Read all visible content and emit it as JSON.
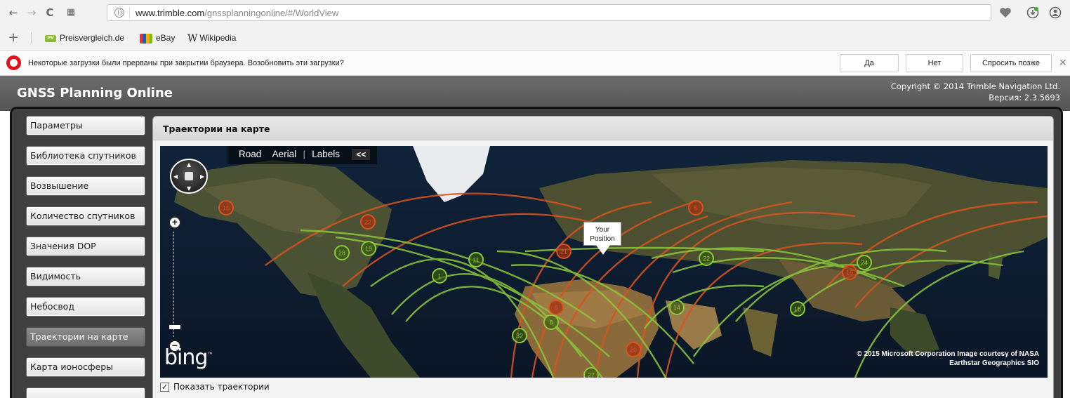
{
  "browser": {
    "url_host": "www.trimble.com",
    "url_path": "/gnssplanningonline/#/WorldView",
    "bookmarks": [
      {
        "label": "Preisvergleich.de"
      },
      {
        "label": "eBay"
      },
      {
        "label": "Wikipedia"
      }
    ],
    "notification": {
      "text": "Некоторые загрузки были прерваны при закрытии браузера. Возобновить эти загрузки?",
      "yes": "Да",
      "no": "Нет",
      "later": "Спросить позже"
    }
  },
  "app": {
    "title": "GNSS Planning Online",
    "copyright": "Copyright © 2014 Trimble Navigation Ltd.",
    "version": "Версия: 2.3.5693"
  },
  "sidebar": {
    "items": [
      {
        "label": "Параметры"
      },
      {
        "label": "Библиотека спутников"
      },
      {
        "label": "Возвышение"
      },
      {
        "label": "Количество спутников"
      },
      {
        "label": "Значения DOP"
      },
      {
        "label": "Видимость"
      },
      {
        "label": "Небосвод"
      },
      {
        "label": "Траектории на карте",
        "active": true
      },
      {
        "label": "Карта ионосферы"
      }
    ]
  },
  "panel": {
    "title": "Траектории на карте",
    "show_trajectories_label": "Показать траектории",
    "show_trajectories_checked": true
  },
  "map": {
    "nav": {
      "road": "Road",
      "aerial": "Aerial",
      "labels": "Labels",
      "collapse": "<<"
    },
    "position_label_1": "Your",
    "position_label_2": "Position",
    "logo": "bing",
    "credit_line_1": "© 2015 Microsoft Corporation   Image courtesy of NASA",
    "credit_line_2": "Earthstar Geographics  SIO",
    "colors": {
      "green": "#8ac93a",
      "orange": "#d9531e"
    },
    "satellites": [
      {
        "id": "15",
        "color": "orange"
      },
      {
        "id": "22",
        "color": "orange"
      },
      {
        "id": "28",
        "color": "green"
      },
      {
        "id": "19",
        "color": "green"
      },
      {
        "id": "1",
        "color": "green"
      },
      {
        "id": "11",
        "color": "green"
      },
      {
        "id": "21",
        "color": "orange"
      },
      {
        "id": "5",
        "color": "orange"
      },
      {
        "id": "22",
        "color": "green"
      },
      {
        "id": "16",
        "color": "orange"
      },
      {
        "id": "24",
        "color": "green"
      },
      {
        "id": "6",
        "color": "orange"
      },
      {
        "id": "8",
        "color": "green"
      },
      {
        "id": "14",
        "color": "green"
      },
      {
        "id": "18",
        "color": "green"
      },
      {
        "id": "32",
        "color": "green"
      },
      {
        "id": "20",
        "color": "orange"
      },
      {
        "id": "27",
        "color": "green"
      }
    ]
  }
}
